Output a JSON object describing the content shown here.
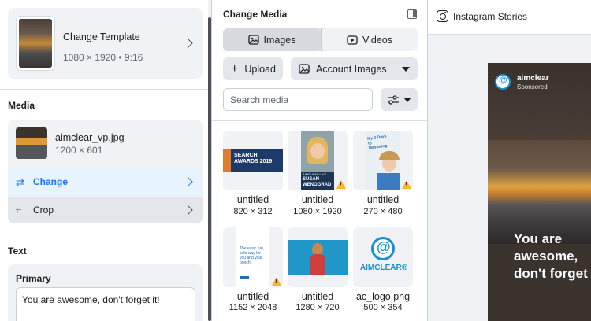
{
  "template": {
    "title": "Change Template",
    "subtitle": "1080 × 1920 • 9:16"
  },
  "media": {
    "section_title": "Media",
    "file_name": "aimclear_vp.jpg",
    "file_dims": "1200 × 601",
    "change_label": "Change",
    "crop_label": "Crop"
  },
  "text_section": {
    "section_title": "Text",
    "primary_label": "Primary",
    "primary_value": "You are awesome, don't forget it!"
  },
  "change_media": {
    "title": "Change Media",
    "tabs": {
      "images": "Images",
      "videos": "Videos"
    },
    "upload_label": "Upload",
    "account_images_label": "Account Images",
    "search_placeholder": "Search media",
    "tiles": [
      {
        "name": "untitled",
        "dims": "820 × 312",
        "warning": false,
        "caption": "SEARCH AWARDS 2019"
      },
      {
        "name": "untitled",
        "dims": "1080 × 1920",
        "warning": true,
        "caption": "SUSAN WENOGRAD",
        "caption_small": "AIMCLEAR LIVE"
      },
      {
        "name": "untitled",
        "dims": "270 × 480",
        "warning": true,
        "caption": "My 2 Days to Mastering"
      },
      {
        "name": "untitled",
        "dims": "1152 × 2048",
        "warning": true,
        "caption": "The easy, fun, safe way for you and your pooch"
      },
      {
        "name": "untitled",
        "dims": "1280 × 720",
        "warning": false
      },
      {
        "name": "ac_logo.png",
        "dims": "500 × 354",
        "warning": false,
        "caption": "AIMCLEAR®"
      }
    ]
  },
  "preview": {
    "placement": "Instagram Stories",
    "page_name": "aimclear",
    "sponsored": "Sponsored",
    "story_text": "You are awesome, don't forget it!"
  },
  "colors": {
    "accent": "#1877f2",
    "warning": "#f7b928",
    "brand": "#1a8fcf"
  }
}
